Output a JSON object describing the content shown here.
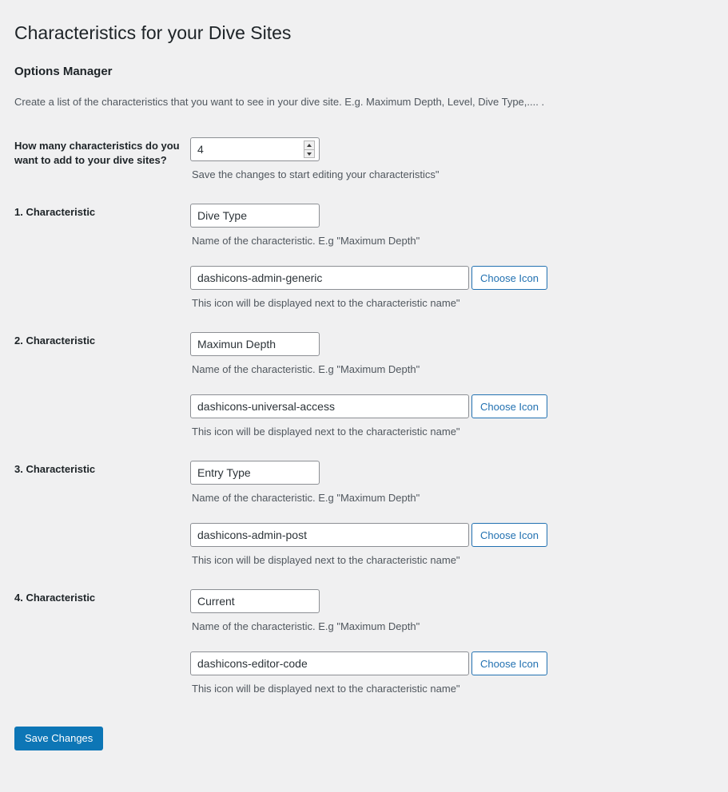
{
  "page": {
    "title": "Characteristics for your Dive Sites",
    "section_title": "Options Manager",
    "section_description": "Create a list of the characteristics that you want to see in your dive site. E.g. Maximum Depth, Level, Dive Type,.... ."
  },
  "count_field": {
    "label": "How many characteristics do you want to add to your dive sites?",
    "value": "4",
    "description": "Save the changes to start editing your characteristics\"",
    "spinner_up": "increment",
    "spinner_down": "decrement"
  },
  "common": {
    "name_description": "Name of the characteristic. E.g \"Maximum Depth\"",
    "icon_description": "This icon will be displayed next to the characteristic name\"",
    "choose_icon_label": "Choose Icon",
    "name_placeholder": "",
    "icon_placeholder": ""
  },
  "characteristics": [
    {
      "label": "1. Characteristic",
      "name_value": "Dive Type",
      "icon_value": "dashicons-admin-generic"
    },
    {
      "label": "2. Characteristic",
      "name_value": "Maximun Depth",
      "icon_value": "dashicons-universal-access"
    },
    {
      "label": "3. Characteristic",
      "name_value": "Entry Type",
      "icon_value": "dashicons-admin-post"
    },
    {
      "label": "4. Characteristic",
      "name_value": "Current",
      "icon_value": "dashicons-editor-code"
    }
  ],
  "submit": {
    "save_label": "Save Changes"
  },
  "colors": {
    "background": "#f0f0f1",
    "text": "#1d2327",
    "muted_text": "#50575e",
    "primary_button": "#0d76b6",
    "link_blue": "#2271b1",
    "input_border": "#8c8f94"
  }
}
